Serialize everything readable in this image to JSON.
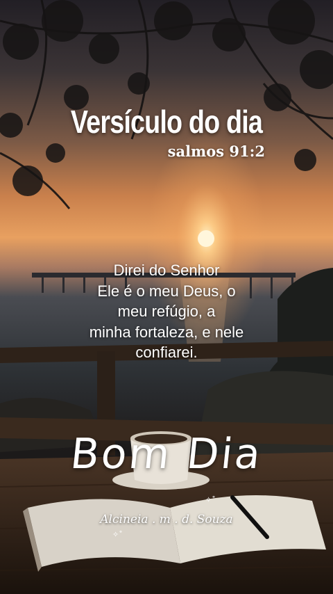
{
  "heading": {
    "title": "Versículo do dia",
    "reference": "salmos 91:2"
  },
  "verse": {
    "lines": [
      "Direi do Senhor",
      "Ele é o meu Deus, o",
      "meu refúgio, a",
      "minha fortaleza, e nele",
      "confiarei."
    ]
  },
  "greeting": "Bom Dia",
  "signature": "Alcineia . m . d. Souza",
  "colors": {
    "sky_top": "#2a2630",
    "sky_glow": "#e89a52",
    "sea": "#3a4248",
    "wood": "#3b2a1e"
  }
}
